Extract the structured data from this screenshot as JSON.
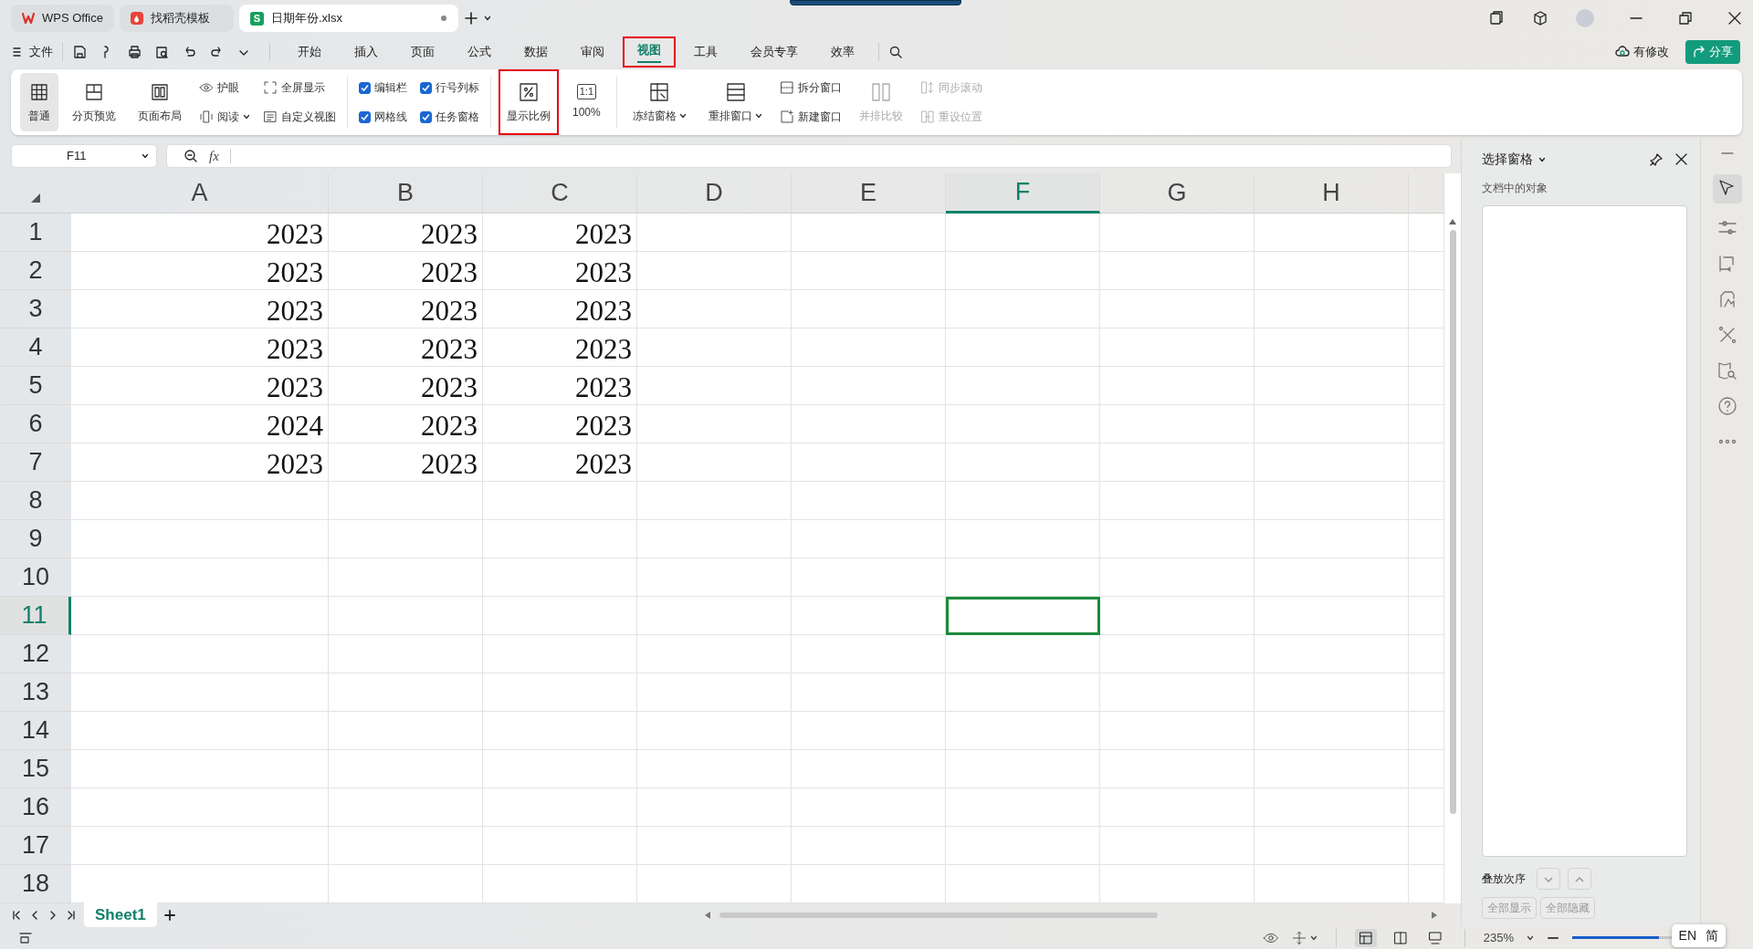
{
  "window_tabs": [
    {
      "label": "WPS Office",
      "kind": "home",
      "selected": false,
      "modified": false
    },
    {
      "label": "找稻壳模板",
      "kind": "template",
      "selected": false,
      "modified": false
    },
    {
      "label": "日期年份.xlsx",
      "kind": "sheet",
      "glyph": "S",
      "selected": true,
      "modified": true
    }
  ],
  "file_menu": "文件",
  "menu_tabs": [
    {
      "label": "开始",
      "selected": false,
      "highlighted": false
    },
    {
      "label": "插入",
      "selected": false,
      "highlighted": false
    },
    {
      "label": "页面",
      "selected": false,
      "highlighted": false
    },
    {
      "label": "公式",
      "selected": false,
      "highlighted": false
    },
    {
      "label": "数据",
      "selected": false,
      "highlighted": false
    },
    {
      "label": "审阅",
      "selected": false,
      "highlighted": false
    },
    {
      "label": "视图",
      "selected": true,
      "highlighted": true
    },
    {
      "label": "工具",
      "selected": false,
      "highlighted": false
    },
    {
      "label": "会员专享",
      "selected": false,
      "highlighted": false
    },
    {
      "label": "效率",
      "selected": false,
      "highlighted": false
    }
  ],
  "save_status": "有修改",
  "share": "分享",
  "ribbon": [
    {
      "kind": "large",
      "label": "普通",
      "selected": true,
      "disabled": false,
      "highlighted": false,
      "dropdown": false
    },
    {
      "kind": "large",
      "label": "分页预览",
      "selected": false,
      "disabled": false,
      "highlighted": false,
      "dropdown": false
    },
    {
      "kind": "large",
      "label": "页面布局",
      "selected": false,
      "disabled": false,
      "highlighted": false,
      "dropdown": false
    },
    {
      "kind": "stack",
      "items": [
        {
          "label": "护眼",
          "disabled": false,
          "dropdown": false
        },
        {
          "label": "阅读",
          "disabled": false,
          "dropdown": true
        }
      ]
    },
    {
      "kind": "stack",
      "items": [
        {
          "label": "全屏显示",
          "disabled": false,
          "dropdown": false
        },
        {
          "label": "自定义视图",
          "disabled": false,
          "dropdown": false
        }
      ]
    },
    {
      "kind": "separator"
    },
    {
      "kind": "checks",
      "items": [
        {
          "label": "编辑栏",
          "checked": true
        },
        {
          "label": "网格线",
          "checked": true
        }
      ]
    },
    {
      "kind": "checks",
      "items": [
        {
          "label": "行号列标",
          "checked": true
        },
        {
          "label": "任务窗格",
          "checked": true
        }
      ]
    },
    {
      "kind": "separator"
    },
    {
      "kind": "large",
      "label": "显示比例",
      "selected": false,
      "disabled": false,
      "highlighted": true,
      "dropdown": false
    },
    {
      "kind": "large",
      "label": "100%",
      "glyph": "1:1",
      "selected": false,
      "disabled": false,
      "highlighted": false,
      "dropdown": false
    },
    {
      "kind": "separator"
    },
    {
      "kind": "large",
      "label": "冻结窗格",
      "selected": false,
      "disabled": false,
      "highlighted": false,
      "dropdown": true
    },
    {
      "kind": "large",
      "label": "重排窗口",
      "selected": false,
      "disabled": false,
      "highlighted": false,
      "dropdown": true
    },
    {
      "kind": "stack",
      "items": [
        {
          "label": "拆分窗口",
          "disabled": false,
          "dropdown": false
        },
        {
          "label": "新建窗口",
          "disabled": false,
          "dropdown": false
        }
      ]
    },
    {
      "kind": "large",
      "label": "并排比较",
      "selected": false,
      "disabled": true,
      "highlighted": false,
      "dropdown": false
    },
    {
      "kind": "stack",
      "items": [
        {
          "label": "同步滚动",
          "disabled": true,
          "dropdown": false
        },
        {
          "label": "重设位置",
          "disabled": true,
          "dropdown": false
        }
      ]
    }
  ],
  "formula_bar": {
    "name_box": "F11",
    "fx": "fx"
  },
  "sheet": {
    "columns": [
      {
        "label": "A",
        "selected": false
      },
      {
        "label": "B",
        "selected": false
      },
      {
        "label": "C",
        "selected": false
      },
      {
        "label": "D",
        "selected": false
      },
      {
        "label": "E",
        "selected": false
      },
      {
        "label": "F",
        "selected": true
      },
      {
        "label": "G",
        "selected": false
      },
      {
        "label": "H",
        "selected": false
      }
    ],
    "rows": [
      {
        "label": "1",
        "selected": false,
        "cells": [
          "2023",
          "2023",
          "2023"
        ]
      },
      {
        "label": "2",
        "selected": false,
        "cells": [
          "2023",
          "2023",
          "2023"
        ]
      },
      {
        "label": "3",
        "selected": false,
        "cells": [
          "2023",
          "2023",
          "2023"
        ]
      },
      {
        "label": "4",
        "selected": false,
        "cells": [
          "2023",
          "2023",
          "2023"
        ]
      },
      {
        "label": "5",
        "selected": false,
        "cells": [
          "2023",
          "2023",
          "2023"
        ]
      },
      {
        "label": "6",
        "selected": false,
        "cells": [
          "2024",
          "2023",
          "2023"
        ]
      },
      {
        "label": "7",
        "selected": false,
        "cells": [
          "2023",
          "2023",
          "2023"
        ]
      },
      {
        "label": "8",
        "selected": false,
        "cells": []
      },
      {
        "label": "9",
        "selected": false,
        "cells": []
      },
      {
        "label": "10",
        "selected": false,
        "cells": []
      },
      {
        "label": "11",
        "selected": true,
        "cells": []
      },
      {
        "label": "12",
        "selected": false,
        "cells": []
      },
      {
        "label": "13",
        "selected": false,
        "cells": []
      },
      {
        "label": "14",
        "selected": false,
        "cells": []
      },
      {
        "label": "15",
        "selected": false,
        "cells": []
      },
      {
        "label": "16",
        "selected": false,
        "cells": []
      },
      {
        "label": "17",
        "selected": false,
        "cells": []
      },
      {
        "label": "18",
        "selected": false,
        "cells": []
      }
    ]
  },
  "sheet_tabs": [
    {
      "label": "Sheet1",
      "selected": true
    }
  ],
  "selection_pane": {
    "title": "选择窗格",
    "subtitle": "文档中的对象",
    "order_label": "叠放次序",
    "order_buttons": [
      {
        "kind": "down",
        "disabled": true
      },
      {
        "kind": "up",
        "disabled": true
      }
    ],
    "buttons": [
      {
        "label": "全部显示",
        "disabled": true
      },
      {
        "label": "全部隐藏",
        "disabled": true
      }
    ]
  },
  "status_bar": {
    "zoom": "235%",
    "zoom_slider": {
      "level": 0.86
    }
  },
  "ime": [
    "EN",
    "简"
  ]
}
